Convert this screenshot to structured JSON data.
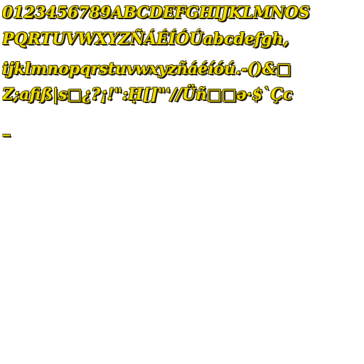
{
  "glyph_sheet": {
    "rows": [
      "0123456789ABCDEFGHIJKLMNOS",
      "PQRTUVWXYZÑÁÉÍÓÚabcdefgh,",
      "ijklmnopqrstuvwxyzñáéíóú.-()&□",
      "Z;afiß|s□¿?¡!\":Ḥ[]\"'//Üñ□□ə·$`Çc",
      "_"
    ],
    "fill_color": "#f2e000",
    "outline_color": "#2a2200",
    "background_color": "#ffffff"
  }
}
